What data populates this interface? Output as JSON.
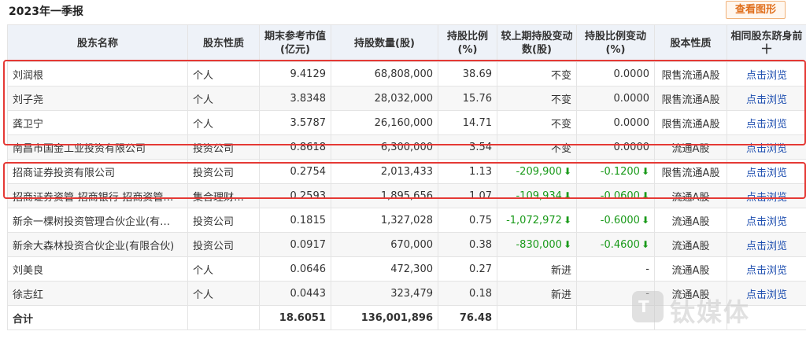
{
  "header": {
    "title": "2023年一季报",
    "chart_button": "查看图形"
  },
  "columns": [
    "股东名称",
    "股东性质",
    "期末参考市值(亿元)",
    "持股数量(股)",
    "持股比例(%)",
    "较上期持股变动数(股)",
    "持股比例变动(%)",
    "股本性质",
    "相同股东跻身前十"
  ],
  "rows": [
    {
      "name": "刘润根",
      "type": "个人",
      "value": "9.4129",
      "shares": "68,808,000",
      "ratio": "38.69",
      "change": "不变",
      "change_pct": "0.0000",
      "kind": "限售流通A股",
      "link": "点击浏览",
      "down": false
    },
    {
      "name": "刘子尧",
      "type": "个人",
      "value": "3.8348",
      "shares": "28,032,000",
      "ratio": "15.76",
      "change": "不变",
      "change_pct": "0.0000",
      "kind": "限售流通A股",
      "link": "点击浏览",
      "down": false
    },
    {
      "name": "龚卫宁",
      "type": "个人",
      "value": "3.5787",
      "shares": "26,160,000",
      "ratio": "14.71",
      "change": "不变",
      "change_pct": "0.0000",
      "kind": "限售流通A股",
      "link": "点击浏览",
      "down": false
    },
    {
      "name": "南昌市国金工业投资有限公司",
      "type": "投资公司",
      "value": "0.8618",
      "shares": "6,300,000",
      "ratio": "3.54",
      "change": "不变",
      "change_pct": "0.0000",
      "kind": "流通A股",
      "link": "点击浏览",
      "down": false
    },
    {
      "name": "招商证券投资有限公司",
      "type": "投资公司",
      "value": "0.2754",
      "shares": "2,013,433",
      "ratio": "1.13",
      "change": "-209,900",
      "change_pct": "-0.1200",
      "kind": "限售流通A股",
      "link": "点击浏览",
      "down": true
    },
    {
      "name": "招商证券资管-招商银行-招商资管…",
      "type": "集合理财…",
      "value": "0.2593",
      "shares": "1,895,656",
      "ratio": "1.07",
      "change": "-109,934",
      "change_pct": "-0.0600",
      "kind": "流通A股",
      "link": "点击浏览",
      "down": true
    },
    {
      "name": "新余一棵树投资管理合伙企业(有…",
      "type": "投资公司",
      "value": "0.1815",
      "shares": "1,327,028",
      "ratio": "0.75",
      "change": "-1,072,972",
      "change_pct": "-0.6000",
      "kind": "流通A股",
      "link": "点击浏览",
      "down": true
    },
    {
      "name": "新余大森林投资合伙企业(有限合伙)",
      "type": "投资公司",
      "value": "0.0917",
      "shares": "670,000",
      "ratio": "0.38",
      "change": "-830,000",
      "change_pct": "-0.4600",
      "kind": "流通A股",
      "link": "点击浏览",
      "down": true
    },
    {
      "name": "刘美良",
      "type": "个人",
      "value": "0.0646",
      "shares": "472,300",
      "ratio": "0.27",
      "change": "新进",
      "change_pct": "-",
      "kind": "流通A股",
      "link": "点击浏览",
      "down": false
    },
    {
      "name": "徐志红",
      "type": "个人",
      "value": "0.0443",
      "shares": "323,479",
      "ratio": "0.18",
      "change": "新进",
      "change_pct": "-",
      "kind": "流通A股",
      "link": "点击浏览",
      "down": false
    }
  ],
  "total": {
    "label": "合计",
    "value": "18.6051",
    "shares": "136,001,896",
    "ratio": "76.48"
  },
  "watermark": {
    "logo": "T",
    "text": "钛媒体"
  },
  "colors": {
    "highlight": "#e53935",
    "down": "#1a9a1a",
    "link": "#1f4fb0",
    "header_bg": "#eef2f8"
  },
  "icons": {
    "down_arrow": "down-arrow-icon"
  }
}
